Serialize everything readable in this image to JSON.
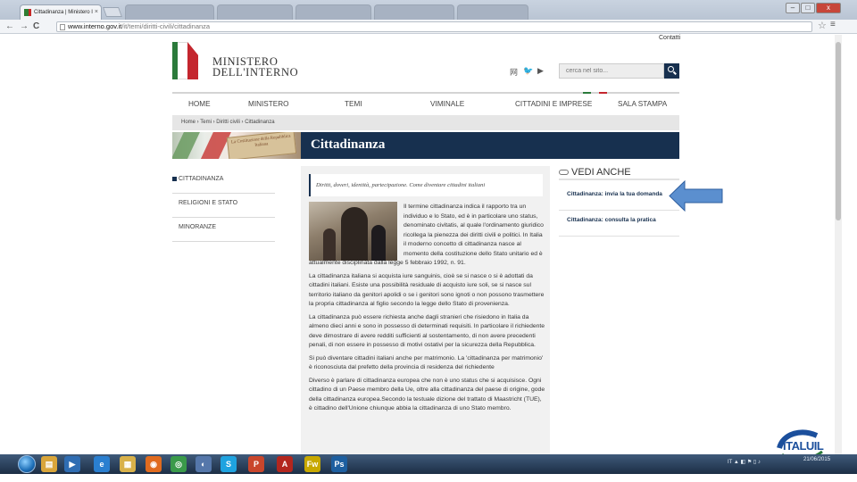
{
  "browser": {
    "active_tab_title": "Cittadinanza | Ministero I",
    "tab_close": "×",
    "url_domain": "www.interno.gov.it",
    "url_path": "/it/temi/diritti-civili/cittadinanza",
    "back": "←",
    "forward": "→",
    "reload": "C",
    "star": "☆",
    "menu": "≡",
    "win_min": "–",
    "win_max": "□",
    "win_close": "x"
  },
  "header": {
    "contatti": "Contatti",
    "logo_line1": "MINISTERO",
    "logo_line2": "DELL'INTERNO",
    "search_placeholder": "cerca nel sito...",
    "social_icons": [
      "rss-icon",
      "twitter-icon",
      "youtube-icon"
    ],
    "social_glyphs": [
      "⽹",
      "🐦",
      "▶"
    ]
  },
  "nav": {
    "items": [
      "HOME",
      "MINISTERO",
      "TEMI",
      "VIMINALE",
      "CITTADINI E IMPRESE",
      "SALA STAMPA"
    ]
  },
  "breadcrumb": "Home › Temi › Diritti civili › Cittadinanza",
  "banner": {
    "book_text": "La Costituzione della Repubblica Italiana",
    "page_title": "Cittadinanza"
  },
  "sidebar": {
    "items": [
      "CITTADINANZA",
      "RELIGIONI E STATO",
      "MINORANZE"
    ]
  },
  "content": {
    "intro": "Diritti, doveri, identità, partecipazione. Come diventare cittadini italiani",
    "paragraphs": [
      "Il termine cittadinanza indica il rapporto tra un individuo e lo Stato, ed è in particolare uno status, denominato civitatis, al quale l'ordinamento giuridico ricollega la pienezza dei diritti civili e politici.  In Italia il moderno concetto di cittadinanza nasce al momento della costituzione dello Stato unitario ed è attualmente disciplinata dalla legge 5 febbraio 1992, n. 91.",
      "La cittadinanza italiana si acquista iure sanguinis, cioè se si nasce o si è adottati da cittadini italiani.  Esiste una possibilità residuale di acquisto iure soli, se si nasce sul territorio italiano da genitori apolidi o se i genitori sono ignoti o non possono trasmettere la propria cittadinanza al figlio secondo la legge dello Stato di provenienza.",
      "La cittadinanza può essere richiesta anche dagli stranieri che risiedono in Italia da almeno dieci anni e sono in possesso di determinati requisiti. In particolare il richiedente deve dimostrare di avere redditi sufficienti al sostentamento, di non avere precedenti penali, di non essere in possesso di motivi ostativi per la sicurezza della Repubblica.",
      "Si può diventare cittadini italiani anche per matrimonio. La 'cittadinanza per matrimonio' è riconosciuta dal prefetto della provincia di residenza del richiedente",
      "Diverso è parlare di cittadinanza europea che non è uno status che si acquisisce. Ogni cittadino di un Paese membro della Ue, oltre alla cittadinanza del paese di origine, gode della cittadinanza europea.Secondo la testuale dizione del trattato di Maastricht (TUE), è cittadino dell'Unione chiunque abbia la cittadinanza di uno Stato membro."
    ]
  },
  "vedi_anche": {
    "heading": "VEDI ANCHE",
    "links": [
      "Cittadinanza: invia la tua domanda",
      "Cittadinanza: consulta la pratica"
    ]
  },
  "corner_logo": "ITALUIL",
  "taskbar": {
    "apps": [
      {
        "name": "explorer-taskbar-icon",
        "glyph": "▤",
        "color": "#d9a53a"
      },
      {
        "name": "media-player-taskbar-icon",
        "glyph": "▶",
        "color": "#2f6db3"
      },
      {
        "name": "ie-taskbar-icon",
        "glyph": "e",
        "color": "#2a7fd0"
      },
      {
        "name": "folder-taskbar-icon",
        "glyph": "▦",
        "color": "#d8b14a"
      },
      {
        "name": "firefox-taskbar-icon",
        "glyph": "◉",
        "color": "#e06b1f"
      },
      {
        "name": "chrome-taskbar-icon",
        "glyph": "◎",
        "color": "#3a9a4a"
      },
      {
        "name": "app-taskbar-icon",
        "glyph": "◐",
        "color": "#5577aa"
      },
      {
        "name": "skype-taskbar-icon",
        "glyph": "S",
        "color": "#1fa3e0"
      },
      {
        "name": "powerpoint-taskbar-icon",
        "glyph": "P",
        "color": "#c9462c"
      },
      {
        "name": "acrobat-taskbar-icon",
        "glyph": "A",
        "color": "#b3261e"
      },
      {
        "name": "fireworks-taskbar-icon",
        "glyph": "Fw",
        "color": "#c7a800"
      },
      {
        "name": "photoshop-taskbar-icon",
        "glyph": "Ps",
        "color": "#1d5fa0"
      }
    ],
    "tray_lang": "IT",
    "tray_icons": "▲ ◧ ⚑ ▯ ♪",
    "date": "21/06/2015"
  }
}
